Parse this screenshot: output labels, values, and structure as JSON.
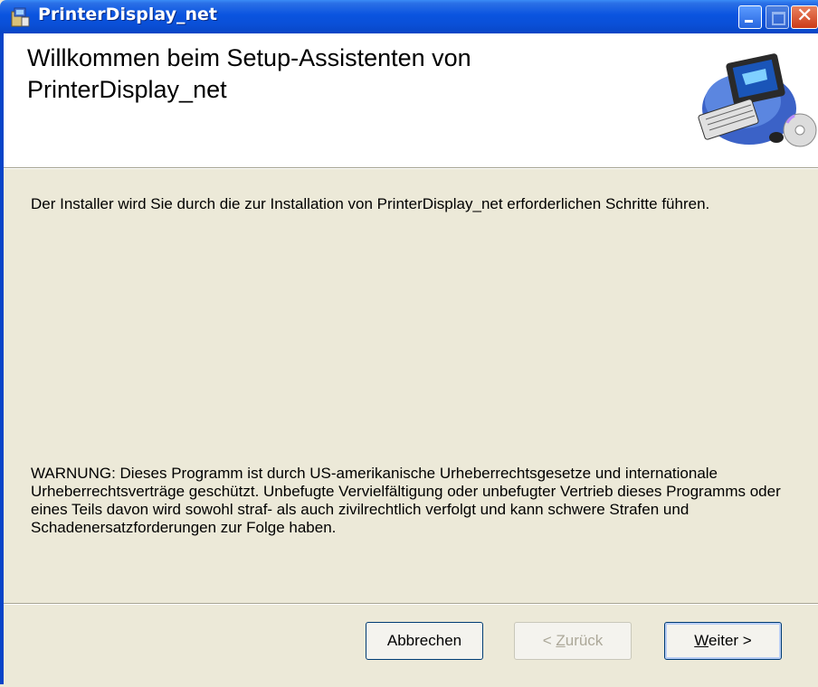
{
  "window": {
    "title": "PrinterDisplay_net",
    "controls": [
      "minimize-icon",
      "maximize-icon",
      "close-icon"
    ]
  },
  "header": {
    "heading_line1": "Willkommen beim Setup-Assistenten von",
    "heading_line2": "PrinterDisplay_net",
    "icon": "computer-setup-icon"
  },
  "body": {
    "intro": "Der Installer wird Sie durch die zur Installation von PrinterDisplay_net erforderlichen Schritte führen.",
    "warning": "WARNUNG: Dieses Programm ist durch US-amerikanische Urheberrechtsgesetze und internationale Urheberrechtsverträge geschützt. Unbefugte Vervielfältigung oder unbefugter Vertrieb dieses Programms oder eines Teils davon wird sowohl straf- als auch zivilrechtlich verfolgt und kann schwere Strafen und Schadenersatzforderungen zur Folge haben."
  },
  "buttons": {
    "cancel": "Abbrechen",
    "back_prefix": "< ",
    "back_access": "Z",
    "back_rest": "urück",
    "next_access": "W",
    "next_rest": "eiter >"
  },
  "colors": {
    "titlebar": "#0a54e0",
    "dialog_bg": "#ece9d8",
    "banner_bg": "#ffffff"
  }
}
